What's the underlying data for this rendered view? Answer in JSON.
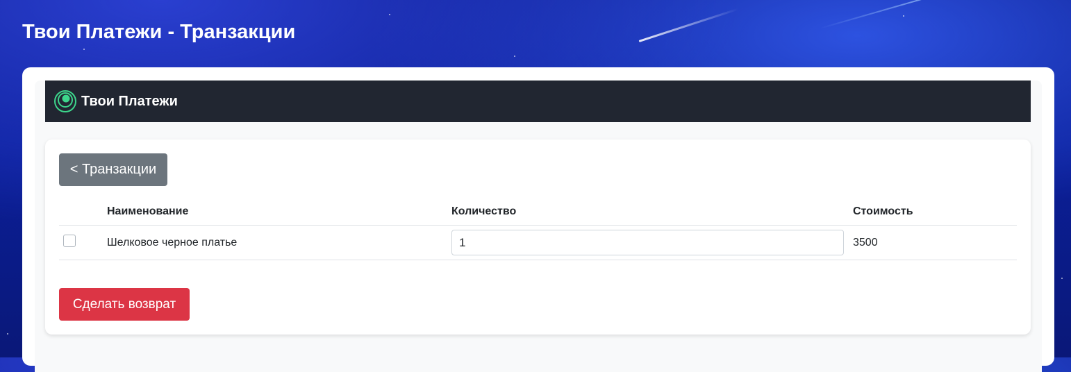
{
  "page": {
    "title": "Твои Платежи - Транзакции"
  },
  "navbar": {
    "brand_name": "Твои Платежи",
    "brand_icon": "concentric-circles-logo",
    "brand_color": "#3dd68c"
  },
  "back_button": {
    "label": "< Транзакции"
  },
  "table": {
    "headers": {
      "name": "Наименование",
      "quantity": "Количество",
      "cost": "Стоимость"
    },
    "rows": [
      {
        "checked": false,
        "name": "Шелковое черное платье",
        "quantity": "1",
        "cost": "3500"
      }
    ]
  },
  "refund_button": {
    "label": "Сделать возврат"
  },
  "colors": {
    "navbar_bg": "#212631",
    "secondary": "#6c757d",
    "danger": "#dc3545"
  }
}
